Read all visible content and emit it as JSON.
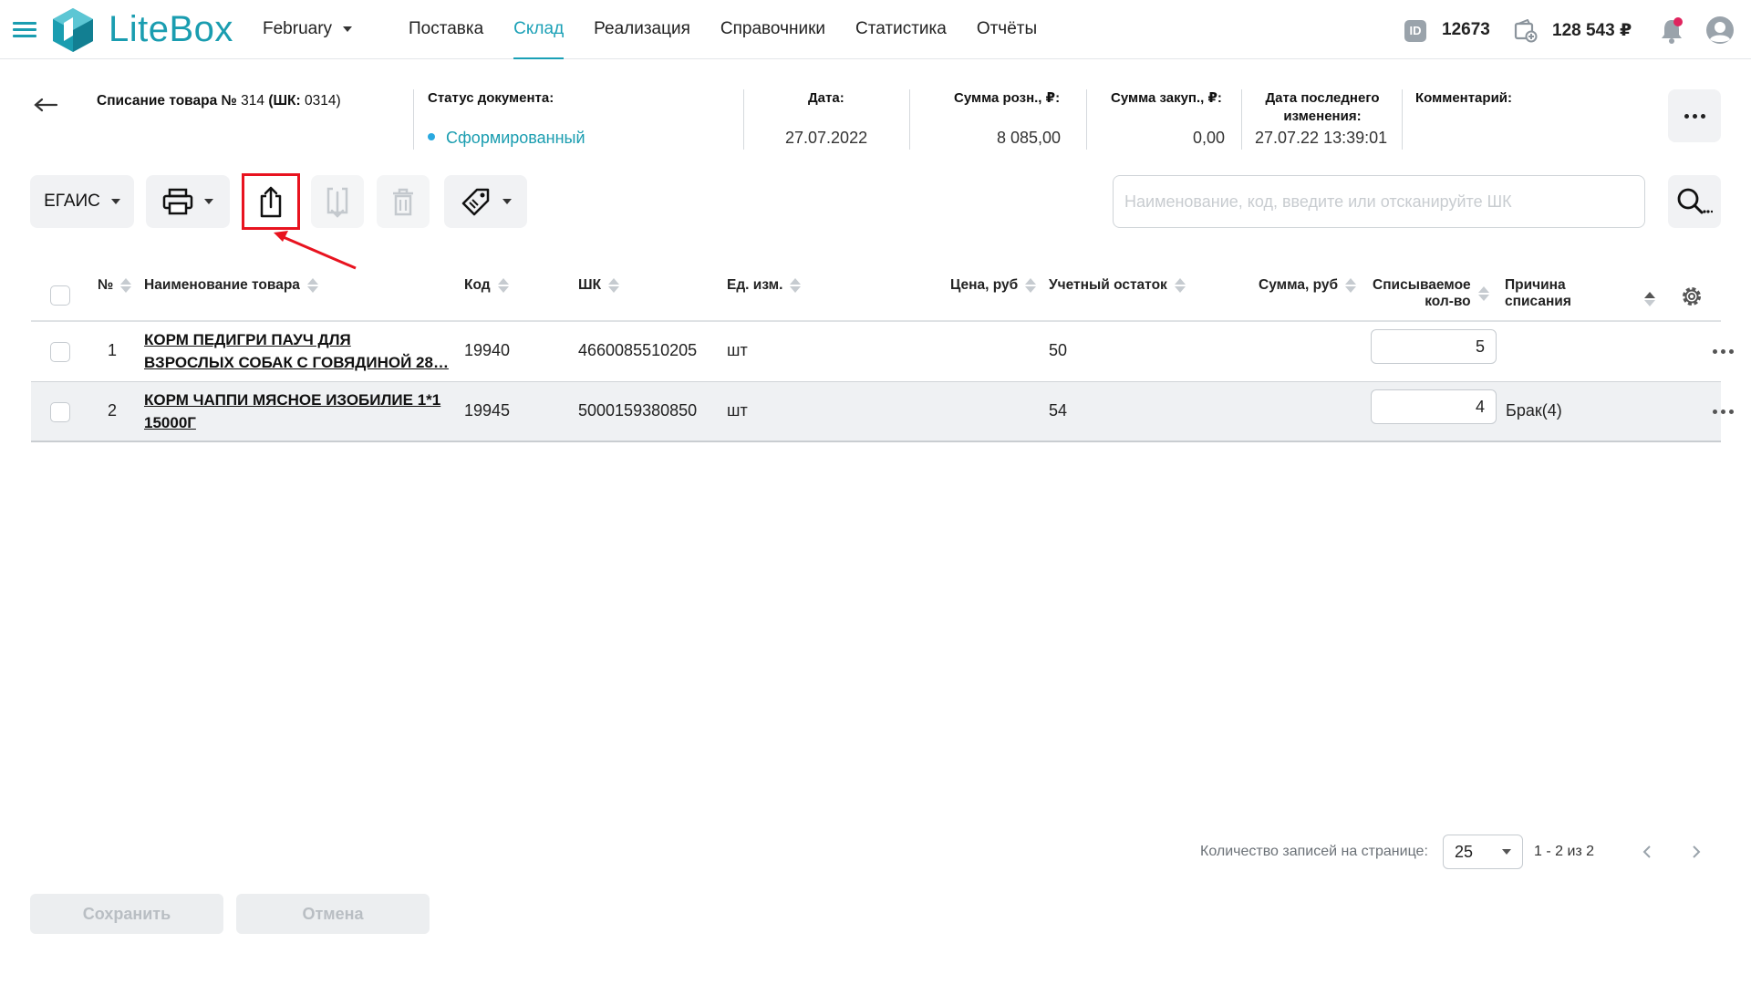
{
  "app": {
    "logo_text": "LiteBox",
    "month": "February",
    "brand_color": "#1a9db0"
  },
  "nav": {
    "items": [
      {
        "label": "Поставка",
        "active": false
      },
      {
        "label": "Склад",
        "active": true
      },
      {
        "label": "Реализация",
        "active": false
      },
      {
        "label": "Справочники",
        "active": false
      },
      {
        "label": "Статистика",
        "active": false
      },
      {
        "label": "Отчёты",
        "active": false
      }
    ]
  },
  "account": {
    "id_badge": "ID",
    "id": "12673",
    "balance": "128 543 ₽"
  },
  "document": {
    "title_prefix": "Списание товара №",
    "number": "314",
    "barcode_label": "(ШК:",
    "barcode": "0314)",
    "status_label": "Статус документа:",
    "status_value": "Сформированный",
    "date_label": "Дата:",
    "date_value": "27.07.2022",
    "retail_sum_label": "Сумма розн., ₽:",
    "retail_sum_value": "8 085,00",
    "purchase_sum_label": "Сумма закуп., ₽:",
    "purchase_sum_value": "0,00",
    "last_change_label_1": "Дата последнего",
    "last_change_label_2": "изменения:",
    "last_change_value": "27.07.22 13:39:01",
    "comment_label": "Комментарий:"
  },
  "toolbar": {
    "egais_label": "ЕГАИС",
    "search_placeholder": "Наименование, код, введите или отсканируйте ШК"
  },
  "table": {
    "headers": {
      "num": "№",
      "name": "Наименование товара",
      "code": "Код",
      "barcode": "ШК",
      "unit": "Ед. изм.",
      "price": "Цена, руб",
      "stock": "Учетный остаток",
      "sum": "Сумма, руб",
      "qty_1": "Списываемое",
      "qty_2": "кол-во",
      "reason_1": "Причина",
      "reason_2": "списания"
    },
    "rows": [
      {
        "num": "1",
        "name_1": "КОРМ ПЕДИГРИ ПАУЧ ДЛЯ",
        "name_2": "ВЗРОСЛЫХ СОБАК С ГОВЯДИНОЙ 28…",
        "code": "19940",
        "barcode": "4660085510205",
        "unit": "шт",
        "price": "",
        "stock": "50",
        "sum": "",
        "qty": "5",
        "reason": ""
      },
      {
        "num": "2",
        "name_1": "КОРМ ЧАППИ МЯСНОЕ ИЗОБИЛИЕ 1*1",
        "name_2": "15000Г",
        "code": "19945",
        "barcode": "5000159380850",
        "unit": "шт",
        "price": "",
        "stock": "54",
        "sum": "",
        "qty": "4",
        "reason": "Брак(4)"
      }
    ]
  },
  "pagination": {
    "per_page_label": "Количество записей на странице:",
    "per_page": "25",
    "range": "1 - 2 из 2"
  },
  "footer": {
    "save_label": "Сохранить",
    "cancel_label": "Отмена"
  }
}
